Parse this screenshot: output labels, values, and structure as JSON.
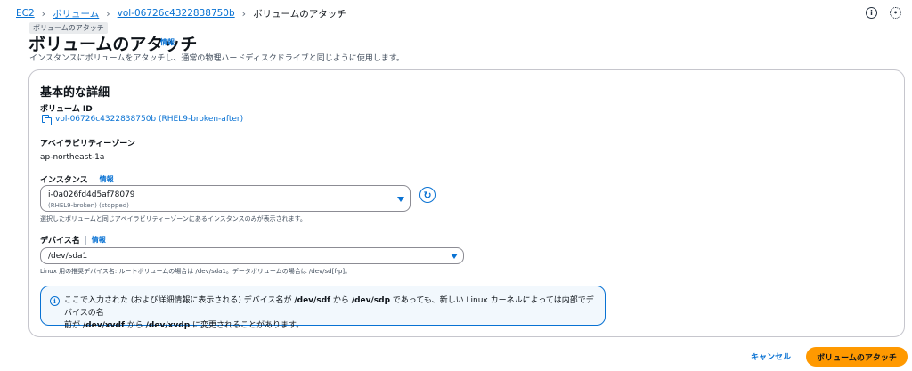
{
  "breadcrumb": {
    "items": [
      "EC2",
      "ボリューム",
      "vol-06726c4322838750b"
    ],
    "current": "ボリュームのアタッチ"
  },
  "top_icons": [
    "info-icon",
    "settings-icon"
  ],
  "tooltip": "ボリュームのアタッチ",
  "page": {
    "title": "ボリュームのアタッチ",
    "info_label": "情報",
    "description": "インスタンスにボリュームをアタッチし、通常の物理ハードディスクドライブと同じように使用します。"
  },
  "panel": {
    "title": "基本的な詳細",
    "volume_id": {
      "label": "ボリューム ID",
      "value": "vol-06726c4322838750b (RHEL9-broken-after)"
    },
    "availability_zone": {
      "label": "アベイラビリティーゾーン",
      "value": "ap-northeast-1a"
    },
    "instance": {
      "label": "インスタンス",
      "info_label": "情報",
      "selected_value": "i-0a026fd4d5af78079",
      "selected_subtext": "(RHEL9-broken) (stopped)",
      "hint": "選択したボリュームと同じアベイラビリティーゾーンにあるインスタンスのみが表示されます。"
    },
    "device_name": {
      "label": "デバイス名",
      "info_label": "情報",
      "selected_value": "/dev/sda1",
      "hint": "Linux 用の推奨デバイス名: ルートボリュームの場合は /dev/sda1。データボリュームの場合は /dev/sd[f-p]。"
    },
    "alert": {
      "line1_a": "ここで入力された (および詳細情報に表示される) デバイス名が ",
      "line1_b": "/dev/sdf",
      "line1_c": " から ",
      "line1_d": "/dev/sdp",
      "line1_e": " であっても、新しい Linux カーネルによっては内部でデバイスの名",
      "line2_a": "前が ",
      "line2_b": "/dev/xvdf",
      "line2_c": " から ",
      "line2_d": "/dev/xvdp",
      "line2_e": " に変更されることがあります。"
    }
  },
  "actions": {
    "cancel_label": "キャンセル",
    "attach_label": "ボリュームのアタッチ"
  },
  "colors": {
    "link": "#0972d3",
    "primary_button": "#ff9900",
    "alert_bg": "#f2f8fd"
  }
}
